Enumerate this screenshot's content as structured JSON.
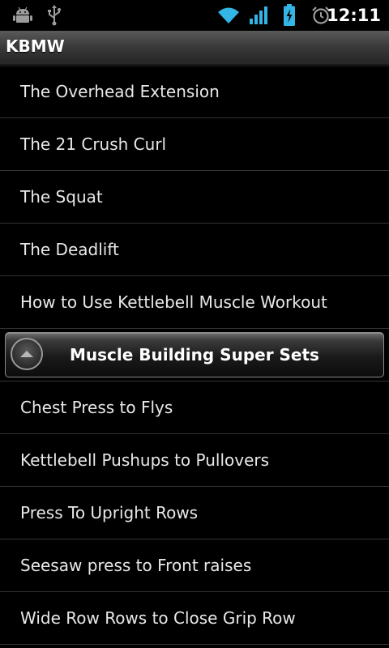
{
  "status_bar": {
    "time": "12:11",
    "icons": [
      "android-debug-icon",
      "usb-icon",
      "wifi-icon",
      "signal-icon",
      "battery-charging-icon",
      "alarm-icon"
    ]
  },
  "app": {
    "title": "KBMW"
  },
  "list": {
    "items_before": [
      {
        "label": "The Overhead Extension"
      },
      {
        "label": "The 21 Crush Curl"
      },
      {
        "label": "The Squat"
      },
      {
        "label": "The Deadlift"
      },
      {
        "label": "How to Use Kettlebell Muscle Workout"
      }
    ],
    "group": {
      "label": "Muscle Building Super Sets",
      "state": "expanded"
    },
    "items_after": [
      {
        "label": "Chest Press to Flys"
      },
      {
        "label": "Kettlebell Pushups to Pullovers"
      },
      {
        "label": "Press To Upright Rows"
      },
      {
        "label": "Seesaw press to Front raises"
      },
      {
        "label": "Wide Row Rows to Close Grip Row"
      }
    ]
  },
  "colors": {
    "background": "#000000",
    "text": "#e8e8e8",
    "divider": "#333333",
    "wifi": "#33b5e5",
    "battery": "#33b5e5"
  }
}
